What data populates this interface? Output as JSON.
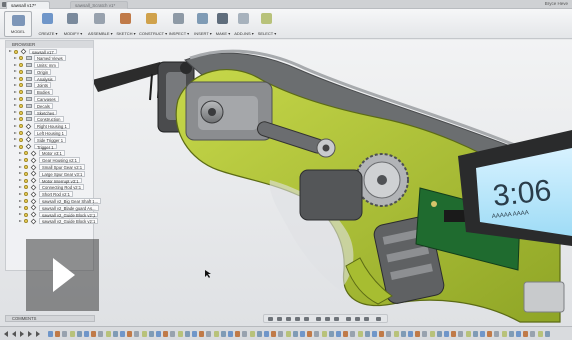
{
  "window": {
    "active_tab": "sawsall v17*",
    "inactive_tab": "sawsall_Scratch v1*",
    "user": "Bryce Heve"
  },
  "toolbar": {
    "workspace": "MODEL",
    "groups": [
      {
        "label": "CREATE ▾",
        "color": "#6f96c9"
      },
      {
        "label": "MODIFY ▾",
        "color": "#7a8a9c"
      },
      {
        "label": "ASSEMBLE ▾",
        "color": "#98a2ae"
      },
      {
        "label": "SKETCH ▾",
        "color": "#c07a48"
      },
      {
        "label": "CONSTRUCT ▾",
        "color": "#d0a24c"
      },
      {
        "label": "INSPECT ▾",
        "color": "#8e9aa6"
      },
      {
        "label": "INSERT ▾",
        "color": "#7f9bb5"
      },
      {
        "label": "MAKE ▾",
        "color": "#5f6d7c"
      },
      {
        "label": "ADD-INS ▾",
        "color": "#a7b2bd"
      },
      {
        "label": "SELECT ▾",
        "color": "#b8c27a"
      }
    ]
  },
  "browser": {
    "header": "BROWSER",
    "items": [
      {
        "label": "sawsall v17",
        "depth": 0,
        "kind": "comp"
      },
      {
        "label": "Named Views",
        "depth": 1,
        "kind": "fold"
      },
      {
        "label": "Units: mm",
        "depth": 1,
        "kind": "fold"
      },
      {
        "label": "Origin",
        "depth": 1,
        "kind": "fold"
      },
      {
        "label": "Analysis",
        "depth": 1,
        "kind": "fold"
      },
      {
        "label": "Joints",
        "depth": 1,
        "kind": "fold"
      },
      {
        "label": "Bodies",
        "depth": 1,
        "kind": "fold"
      },
      {
        "label": "Canvases",
        "depth": 1,
        "kind": "fold"
      },
      {
        "label": "Decals",
        "depth": 1,
        "kind": "fold"
      },
      {
        "label": "Sketches",
        "depth": 1,
        "kind": "fold"
      },
      {
        "label": "Construction",
        "depth": 1,
        "kind": "fold"
      },
      {
        "label": "Right Housing 1",
        "depth": 1,
        "kind": "comp"
      },
      {
        "label": "Left Housing 1",
        "depth": 1,
        "kind": "comp"
      },
      {
        "label": "Side Trigger 1",
        "depth": 1,
        "kind": "comp"
      },
      {
        "label": "Trigger 1",
        "depth": 1,
        "kind": "comp"
      },
      {
        "label": "Motor v3:1",
        "depth": 2,
        "kind": "comp"
      },
      {
        "label": "Gear Housing v2:1",
        "depth": 2,
        "kind": "comp"
      },
      {
        "label": "Small Spur Gear v2:1",
        "depth": 2,
        "kind": "comp"
      },
      {
        "label": "Large Spur Gear v3:1",
        "depth": 2,
        "kind": "comp"
      },
      {
        "label": "Motor Interrupt v3:1",
        "depth": 2,
        "kind": "comp"
      },
      {
        "label": "Connecting Rod v2:1",
        "depth": 2,
        "kind": "comp"
      },
      {
        "label": "Short Rod v2:1",
        "depth": 2,
        "kind": "comp"
      },
      {
        "label": "sawsall v2_Big Gear Shaft 1...",
        "depth": 2,
        "kind": "comp"
      },
      {
        "label": "sawsall v2_Blade guard As...",
        "depth": 2,
        "kind": "comp"
      },
      {
        "label": "sawsall v2_Guide Block v2:1",
        "depth": 2,
        "kind": "comp"
      },
      {
        "label": "sawsall v2_Guide Block v2:1",
        "depth": 2,
        "kind": "comp"
      }
    ]
  },
  "comments": {
    "label": "COMMENTS"
  },
  "display": {
    "clock": "3:06",
    "sub": "AAAAA AAAA"
  }
}
